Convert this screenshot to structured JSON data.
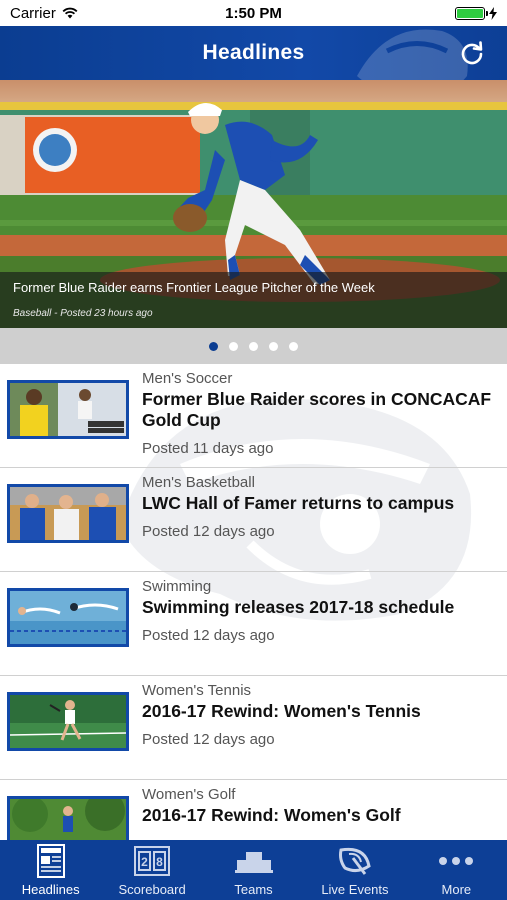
{
  "status_bar": {
    "carrier": "Carrier",
    "time": "1:50 PM",
    "battery_level": 1.0
  },
  "nav": {
    "title": "Headlines",
    "refresh_icon": "refresh-icon"
  },
  "hero": {
    "title": "Former Blue Raider earns Frontier League Pitcher of the Week",
    "meta": "Baseball - Posted 23 hours ago",
    "pages": 5,
    "active_page": 0
  },
  "news": [
    {
      "category": "Men's Soccer",
      "title": "Former Blue Raider scores in CONCACAF Gold Cup",
      "date": "Posted 11 days ago"
    },
    {
      "category": "Men's Basketball",
      "title": "LWC Hall of Famer returns to campus",
      "date": "Posted 12 days ago"
    },
    {
      "category": "Swimming",
      "title": "Swimming releases 2017-18 schedule",
      "date": "Posted 12 days ago"
    },
    {
      "category": "Women's Tennis",
      "title": "2016-17 Rewind: Women's Tennis",
      "date": "Posted 12 days ago"
    },
    {
      "category": "Women's Golf",
      "title": "2016-17 Rewind: Women's Golf",
      "date": ""
    }
  ],
  "tabs": [
    {
      "label": "Headlines",
      "icon": "newspaper-icon",
      "active": true
    },
    {
      "label": "Scoreboard",
      "icon": "scoreboard-icon",
      "active": false
    },
    {
      "label": "Teams",
      "icon": "teams-icon",
      "active": false
    },
    {
      "label": "Live Events",
      "icon": "satellite-icon",
      "active": false
    },
    {
      "label": "More",
      "icon": "more-dots-icon",
      "active": false
    }
  ],
  "colors": {
    "brand_blue": "#0b3d91",
    "accent_blue": "#1249a8",
    "battery_green": "#2ecc40"
  }
}
